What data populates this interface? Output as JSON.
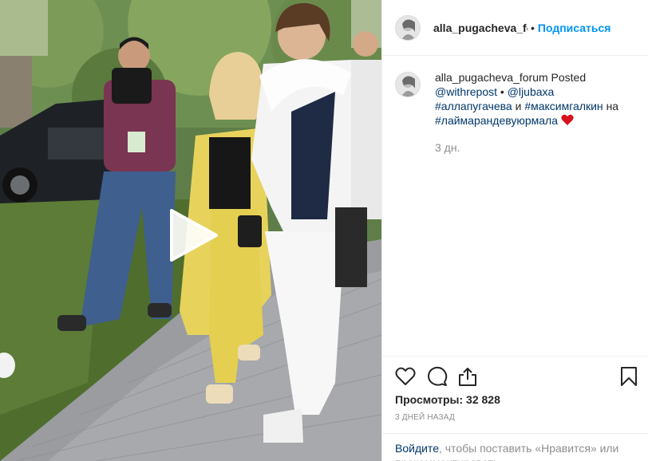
{
  "post": {
    "username": "alla_pugacheva_forum",
    "header_username": "alla_pugacheva_foı",
    "dot": "•",
    "follow_label": "Подписаться"
  },
  "caption": {
    "username": "alla_pugacheva_forum",
    "posted_word": "Posted",
    "mention_1": "@withrepost",
    "bullet": "•",
    "mention_2": "@ljubaxa",
    "hashtag_1": "#аллапугачева",
    "and_word": "и",
    "hashtag_2": "#максимгалкин",
    "on_word": "на",
    "hashtag_3": "#лаймарандевуюрмала",
    "heart_icon": "red-heart-emoji",
    "time_ago": "3 дн."
  },
  "actions": {
    "like_icon": "heart-outline-icon",
    "comment_icon": "comment-bubble-icon",
    "share_icon": "share-upload-icon",
    "save_icon": "bookmark-icon"
  },
  "stats": {
    "views_label": "Просмотры: 32 828",
    "date": "3 ДНЕЙ НАЗАД"
  },
  "login": {
    "link": "Войдите",
    "text": ", чтобы поставить «Нравится» или прокомментировать."
  },
  "media": {
    "type": "video",
    "play_icon": "play-icon"
  },
  "colors": {
    "link": "#00376b",
    "follow": "#0095f6",
    "muted": "#8e8e8e",
    "heart": "#ed4956"
  }
}
